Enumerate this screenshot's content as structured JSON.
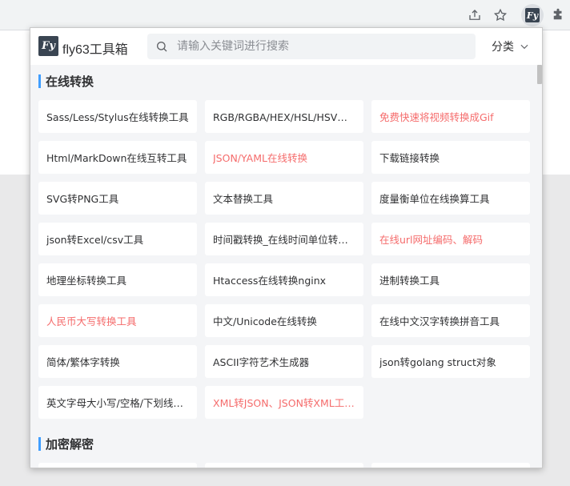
{
  "extension": {
    "title": "fly63工具箱",
    "logo_text": "Fy",
    "search_placeholder": "请输入关键词进行搜索",
    "category_label": "分类"
  },
  "sections": [
    {
      "title": "在线转换",
      "tools": [
        {
          "label": "Sass/Less/Stylus在线转换工具",
          "hot": false
        },
        {
          "label": "RGB/RGBA/HEX/HSL/HSV颜…",
          "hot": false
        },
        {
          "label": "免费快速将视频转换成Gif",
          "hot": true
        },
        {
          "label": "Html/MarkDown在线互转工具",
          "hot": false
        },
        {
          "label": "JSON/YAML在线转换",
          "hot": true
        },
        {
          "label": "下载链接转换",
          "hot": false
        },
        {
          "label": "SVG转PNG工具",
          "hot": false
        },
        {
          "label": "文本替换工具",
          "hot": false
        },
        {
          "label": "度量衡单位在线换算工具",
          "hot": false
        },
        {
          "label": "json转Excel/csv工具",
          "hot": false
        },
        {
          "label": "时间戳转换_在线时间单位转…",
          "hot": false
        },
        {
          "label": "在线url网址编码、解码",
          "hot": true
        },
        {
          "label": "地理坐标转换工具",
          "hot": false
        },
        {
          "label": "Htaccess在线转换nginx",
          "hot": false
        },
        {
          "label": "进制转换工具",
          "hot": false
        },
        {
          "label": "人民币大写转换工具",
          "hot": true
        },
        {
          "label": "中文/Unicode在线转换",
          "hot": false
        },
        {
          "label": "在线中文汉字转换拼音工具",
          "hot": false
        },
        {
          "label": "简体/繁体字转换",
          "hot": false
        },
        {
          "label": "ASCII字符艺术生成器",
          "hot": false
        },
        {
          "label": "json转golang struct对象",
          "hot": false
        },
        {
          "label": "英文字母大小写/空格/下划线…",
          "hot": false
        },
        {
          "label": "XML转JSON、JSON转XML工…",
          "hot": true
        }
      ]
    },
    {
      "title": "加密解密",
      "tools": [
        {
          "label": "",
          "hot": false
        },
        {
          "label": "",
          "hot": false
        },
        {
          "label": "",
          "hot": false
        }
      ]
    }
  ]
}
